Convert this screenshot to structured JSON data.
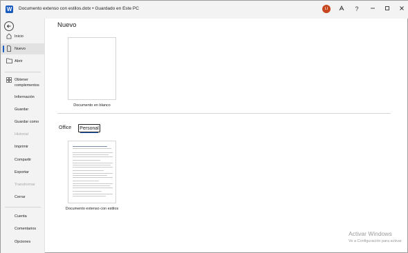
{
  "titlebar": {
    "app_icon_letter": "W",
    "document_title": "Documento extenso con estilos.dotx",
    "separator": "•",
    "save_status": "Guardado en Este PC",
    "user_initials": "LI",
    "icons": [
      "designer-icon",
      "help-icon",
      "minimize-icon",
      "restore-icon",
      "close-icon"
    ]
  },
  "sidebar": {
    "back_icon": "back-arrow-icon",
    "items": [
      {
        "label": "Inicio",
        "icon": "home-icon"
      },
      {
        "label": "Nuevo",
        "icon": "new-document-icon"
      },
      {
        "label": "Abrir",
        "icon": "open-folder-icon"
      },
      {
        "label": "Obtener complementos",
        "icon": "grid-icon"
      },
      {
        "label": "Información"
      },
      {
        "label": "Guardar"
      },
      {
        "label": "Guardar como"
      },
      {
        "label": "Historial"
      },
      {
        "label": "Imprimir"
      },
      {
        "label": "Compartir"
      },
      {
        "label": "Exportar"
      },
      {
        "label": "Transformar"
      },
      {
        "label": "Cerrar"
      },
      {
        "label": "Cuenta"
      },
      {
        "label": "Comentarios"
      },
      {
        "label": "Opciones"
      }
    ]
  },
  "main": {
    "title": "Nuevo",
    "blank_document_label": "Documento en blanco",
    "tabs": [
      {
        "label": "Office"
      },
      {
        "label": "Personal"
      }
    ],
    "templates": [
      {
        "label": "Documento extenso con estilos"
      }
    ]
  },
  "watermark": {
    "title": "Activar Windows",
    "subtitle": "Ve a Configuración para activar"
  }
}
